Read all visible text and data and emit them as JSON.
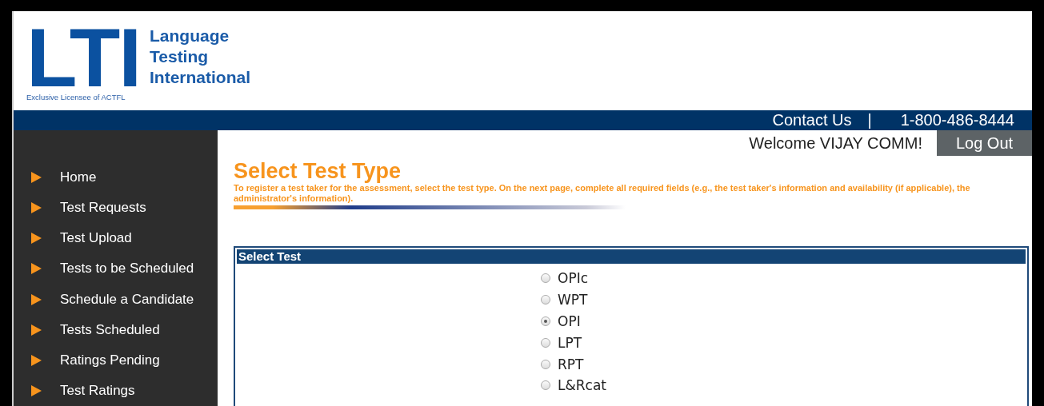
{
  "logo": {
    "letters": "LTI",
    "name_lines": [
      "Language",
      "Testing",
      "International"
    ],
    "tagline": "Exclusive Licensee of ACTFL"
  },
  "top_bar": {
    "contact": "Contact Us",
    "separator": "|",
    "phone": "1-800-486-8444"
  },
  "user_bar": {
    "welcome": "Welcome VIJAY COMM!",
    "logout": "Log Out"
  },
  "sidebar": {
    "items": [
      {
        "label": "Home"
      },
      {
        "label": "Test Requests"
      },
      {
        "label": "Test Upload"
      },
      {
        "label": "Tests to be Scheduled"
      },
      {
        "label": "Schedule a Candidate"
      },
      {
        "label": "Tests Scheduled"
      },
      {
        "label": "Ratings Pending"
      },
      {
        "label": "Test Ratings"
      }
    ]
  },
  "page": {
    "title": "Select Test Type",
    "instructions": "To register a test taker for the assessment, select the test type. On the next page, complete all required fields (e.g., the test taker's information and availability (if applicable), the administrator's information)."
  },
  "select_test": {
    "header": "Select Test",
    "options": [
      {
        "label": "OPIc",
        "selected": false
      },
      {
        "label": "WPT",
        "selected": false
      },
      {
        "label": "OPI",
        "selected": true
      },
      {
        "label": "LPT",
        "selected": false
      },
      {
        "label": "RPT",
        "selected": false
      },
      {
        "label": "L&Rcat",
        "selected": false
      }
    ]
  }
}
